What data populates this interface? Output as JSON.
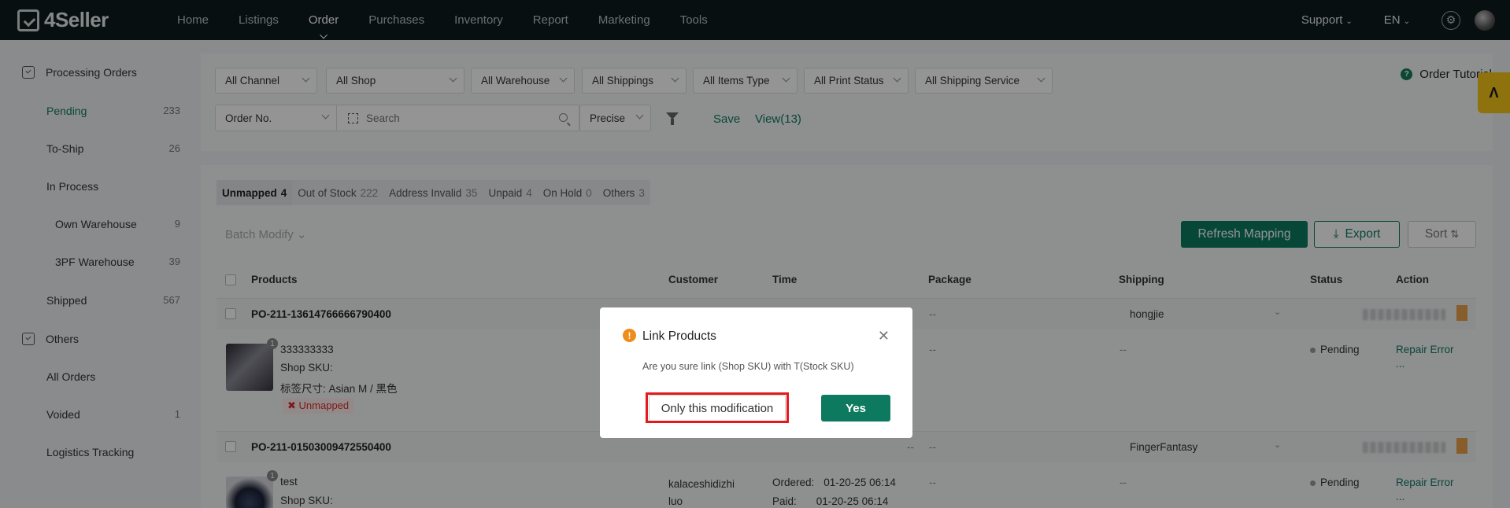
{
  "brand": {
    "name": "4Seller"
  },
  "nav": {
    "items": [
      "Home",
      "Listings",
      "Order",
      "Purchases",
      "Inventory",
      "Report",
      "Marketing",
      "Tools"
    ],
    "active": "Order",
    "support": "Support",
    "lang": "EN"
  },
  "sidebar": {
    "processing_title": "Processing Orders",
    "others_title": "Others",
    "items": [
      {
        "label": "Pending",
        "count": "233"
      },
      {
        "label": "To-Ship",
        "count": "26"
      },
      {
        "label": "In Process",
        "count": ""
      },
      {
        "label": "Own Warehouse",
        "count": "9"
      },
      {
        "label": "3PF Warehouse",
        "count": "39"
      },
      {
        "label": "Shipped",
        "count": "567"
      }
    ],
    "others": [
      {
        "label": "All Orders",
        "count": ""
      },
      {
        "label": "Voided",
        "count": "1"
      },
      {
        "label": "Logistics Tracking",
        "count": ""
      }
    ]
  },
  "filters": {
    "channel": "All Channel",
    "shop": "All Shop",
    "warehouse": "All Warehouse",
    "shippings": "All Shippings",
    "items_type": "All Items Type",
    "print_status": "All Print Status",
    "shipping_service": "All Shipping Service",
    "search_field": "Order No.",
    "search_placeholder": "Search",
    "match_mode": "Precise",
    "save": "Save",
    "view": "View(13)",
    "tutorial": "Order Tutorial"
  },
  "tabs": [
    {
      "label": "Unmapped",
      "count": "4"
    },
    {
      "label": "Out of Stock",
      "count": "222"
    },
    {
      "label": "Address Invalid",
      "count": "35"
    },
    {
      "label": "Unpaid",
      "count": "4"
    },
    {
      "label": "On Hold",
      "count": "0"
    },
    {
      "label": "Others",
      "count": "3"
    }
  ],
  "toolbar": {
    "batch_modify": "Batch Modify",
    "refresh_mapping": "Refresh Mapping",
    "export": "Export",
    "sort": "Sort"
  },
  "table": {
    "headers": [
      "Products",
      "Customer",
      "Time",
      "Package",
      "Shipping",
      "Status",
      "Action"
    ]
  },
  "orders": [
    {
      "id": "PO-211-13614766666790400",
      "package_top": "--",
      "shipping_name": "hongjie",
      "product_name": "333333333",
      "shop_sku": "Shop SKU:",
      "variant": "标签尺寸: Asian M / 黑色",
      "qty_badge": "1",
      "tag": "Unmapped",
      "package": "--",
      "shipping": "--",
      "status": "Pending",
      "action": "Repair Error",
      "more": "..."
    },
    {
      "id": "PO-211-01503009472550400",
      "dash_left": "--",
      "package_top": "--",
      "shipping_name": "FingerFantasy",
      "product_name": "test",
      "shop_sku": "Shop SKU:",
      "qty_badge": "1",
      "customer_line1": "kalaceshidizhi",
      "customer_line2": "luo",
      "ordered_label": "Ordered:",
      "ordered": "01-20-25 06:14",
      "paid_label": "Paid:",
      "paid": "01-20-25 06:14",
      "package": "--",
      "shipping": "--",
      "status": "Pending",
      "action": "Repair Error",
      "more": "..."
    }
  ],
  "modal": {
    "title": "Link Products",
    "message": "Are you sure link (Shop SKU) with T(Stock SKU)",
    "only_this": "Only this modification",
    "yes": "Yes"
  },
  "colors": {
    "primary": "#0d7a5f",
    "nav_bg": "#0f1a1c",
    "warning": "#f08c1a",
    "highlight": "#e5181e",
    "side_tab": "#f5c518"
  }
}
